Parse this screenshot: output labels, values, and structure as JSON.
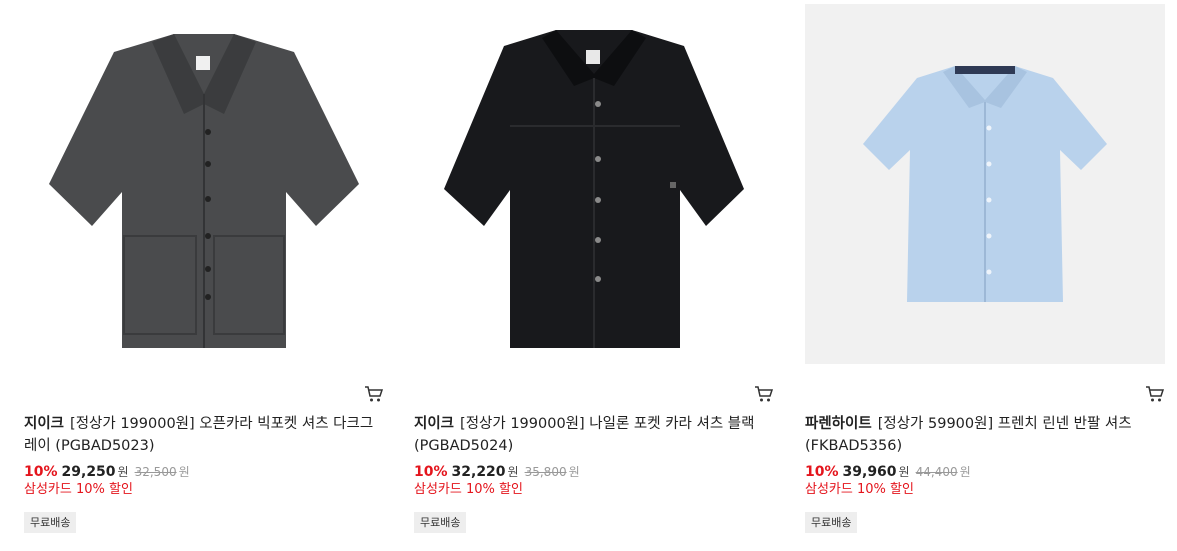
{
  "products": [
    {
      "brand": "지이크",
      "name": "[정상가 199000원] 오픈카라 빅포켓 셔츠 다크그레이 (PGBAD5023)",
      "discount_rate": "10%",
      "sale_price": "29,250",
      "sale_unit": "원",
      "original_price": "32,500",
      "original_unit": "원",
      "card_discount": "삼성카드 10% 할인",
      "shipping_badge": "무료배송",
      "shirt_color": "#4a4b4d"
    },
    {
      "brand": "지이크",
      "name": "[정상가 199000원] 나일론 포켓 카라 셔츠 블랙 (PGBAD5024)",
      "discount_rate": "10%",
      "sale_price": "32,220",
      "sale_unit": "원",
      "original_price": "35,800",
      "original_unit": "원",
      "card_discount": "삼성카드 10% 할인",
      "shipping_badge": "무료배송",
      "shirt_color": "#18191c"
    },
    {
      "brand": "파렌하이트",
      "name": "[정상가 59900원] 프렌치 린넨 반팔 셔츠 (FKBAD5356)",
      "discount_rate": "10%",
      "sale_price": "39,960",
      "sale_unit": "원",
      "original_price": "44,400",
      "original_unit": "원",
      "card_discount": "삼성카드 10% 할인",
      "shipping_badge": "무료배송",
      "shirt_color": "#b9d2ec"
    }
  ],
  "colors": {
    "discount_red": "#e4151d",
    "badge_bg": "#eeeeee",
    "thumb_bg_light": "#f1f1f1"
  },
  "icons": {
    "cart": "cart-icon"
  }
}
